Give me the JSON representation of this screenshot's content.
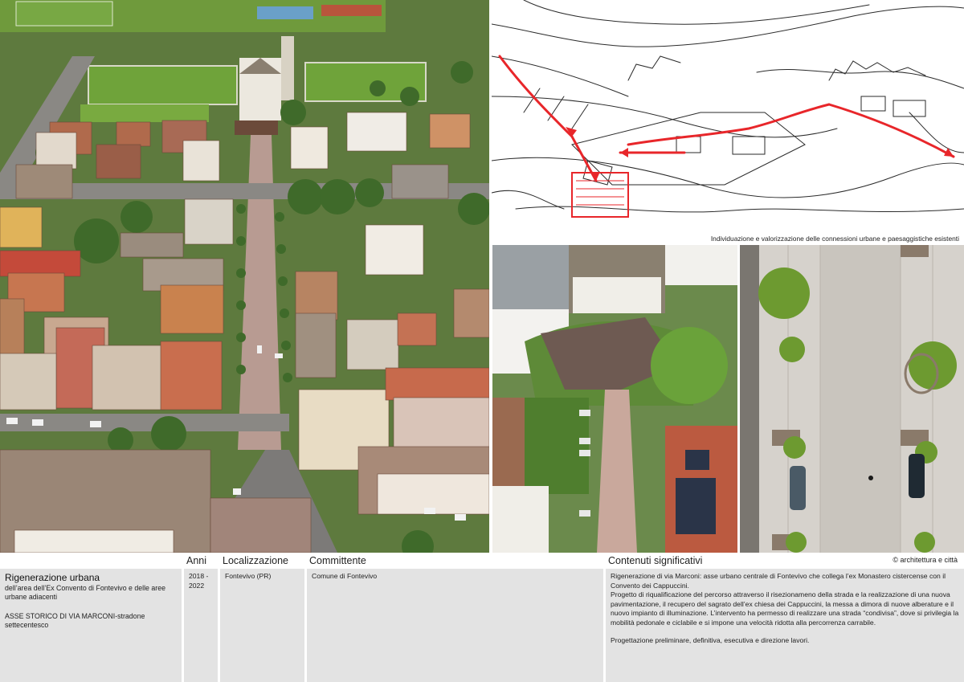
{
  "sketch_caption": "Individuazione e valorizzazione delle connessioni urbane e paesaggistiche esistenti",
  "project": {
    "title": "Rigenerazione urbana",
    "subtitle": "dell’area dell’Ex Convento di Fontevivo e delle aree urbane adiacenti",
    "axis": "ASSE STORICO DI VIA MARCONI-stradone settecentesco"
  },
  "columns": {
    "years_header": "Anni",
    "years_value": "2018 - 2022",
    "location_header": "Localizzazione",
    "location_value": "Fontevivo (PR)",
    "client_header": "Committente",
    "client_value": "Comune di Fontevivo",
    "content_header": "Contenuti significativi",
    "copyright": "© architettura e città"
  },
  "content": {
    "p1": "Rigenerazione di via Marconi: asse urbano centrale di Fontevivo che collega l’ex Monastero cistercense con il Convento dei Cappuccini.",
    "p2": "Progetto di riqualificazione del percorso attraverso il risezionameno della strada e la realizzazione di una nuova pavimentazione, il recupero del sagrato dell’ex chiesa dei Cappuccini, la messa a dimora di nuove alberature e il nuovo impianto di illuminazione. L’intervento ha permesso di realizzare una strada “condivisa”, dove si privilegia la mobilità pedonale e ciclabile e si impone una velocità ridotta alla percorrenza carrabile.",
    "p3": "Progettazione preliminare, definitiva, esecutiva e direzione lavori."
  },
  "colors": {
    "panel_gray": "#e3e3e3",
    "sketch_red": "#e8262a"
  }
}
